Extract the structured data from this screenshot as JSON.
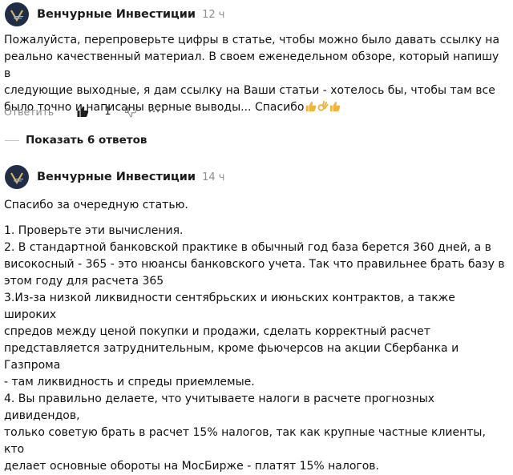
{
  "comments": [
    {
      "author": "Венчурные Инвестиции",
      "time": "12 ч",
      "text_lines": [
        "Пожалуйста, перепроверьте цифры в статье, чтобы можно было давать ссылку на",
        "реально качественный материал. В своем еженедельном обзоре, который напишу в",
        "следующие выходные, я дам ссылку на Ваши статьи - хотелось бы, чтобы там все",
        "было точно и написаны верные выводы... Спасибо"
      ],
      "emojis": [
        "thumbs-up",
        "ok-hand",
        "thumbs-up"
      ],
      "actions": {
        "reply_label": "Ответить",
        "like_count": "1"
      },
      "show_replies_label": "Показать 6 ответов"
    },
    {
      "author": "Венчурные Инвестиции",
      "time": "14 ч",
      "paragraphs": [
        [
          "Спасибо за очередную статью."
        ],
        [
          "1. Проверьте эти вычисления.",
          "2. В стандартной банковской практике в обычный год база берется 360 дней, а в",
          "високосный - 365 - это нюансы банковского учета. Так что правильнее брать базу в",
          "этом году для расчета 365",
          "3.Из-за низкой ликвидности сентябрьских и июньских контрактов, а также широких",
          "спредов между ценой покупки и продажи, сделать корректный расчет",
          "представляется затруднительным, кроме фьючерсов на акции Сбербанка и Газпрома",
          "- там ликвидность и спреды приемлемые.",
          "4. Вы правильно делаете, что учитываете налоги в расчете прогнозных дивидендов,",
          "только советую брать в расчет 15% налогов, так как крупные частные клиенты, кто",
          "делает основные обороты на МосБирже - платят 15% налогов."
        ]
      ]
    }
  ],
  "colors": {
    "avatar_bg": "#1f2d47",
    "avatar_logo": "#d8b15a",
    "muted_text": "#8a8a8a",
    "emoji": "#f2b33d"
  },
  "icons": [
    "avatar-logo",
    "thumbs-up-icon",
    "thumbs-down-icon",
    "more-icon"
  ]
}
